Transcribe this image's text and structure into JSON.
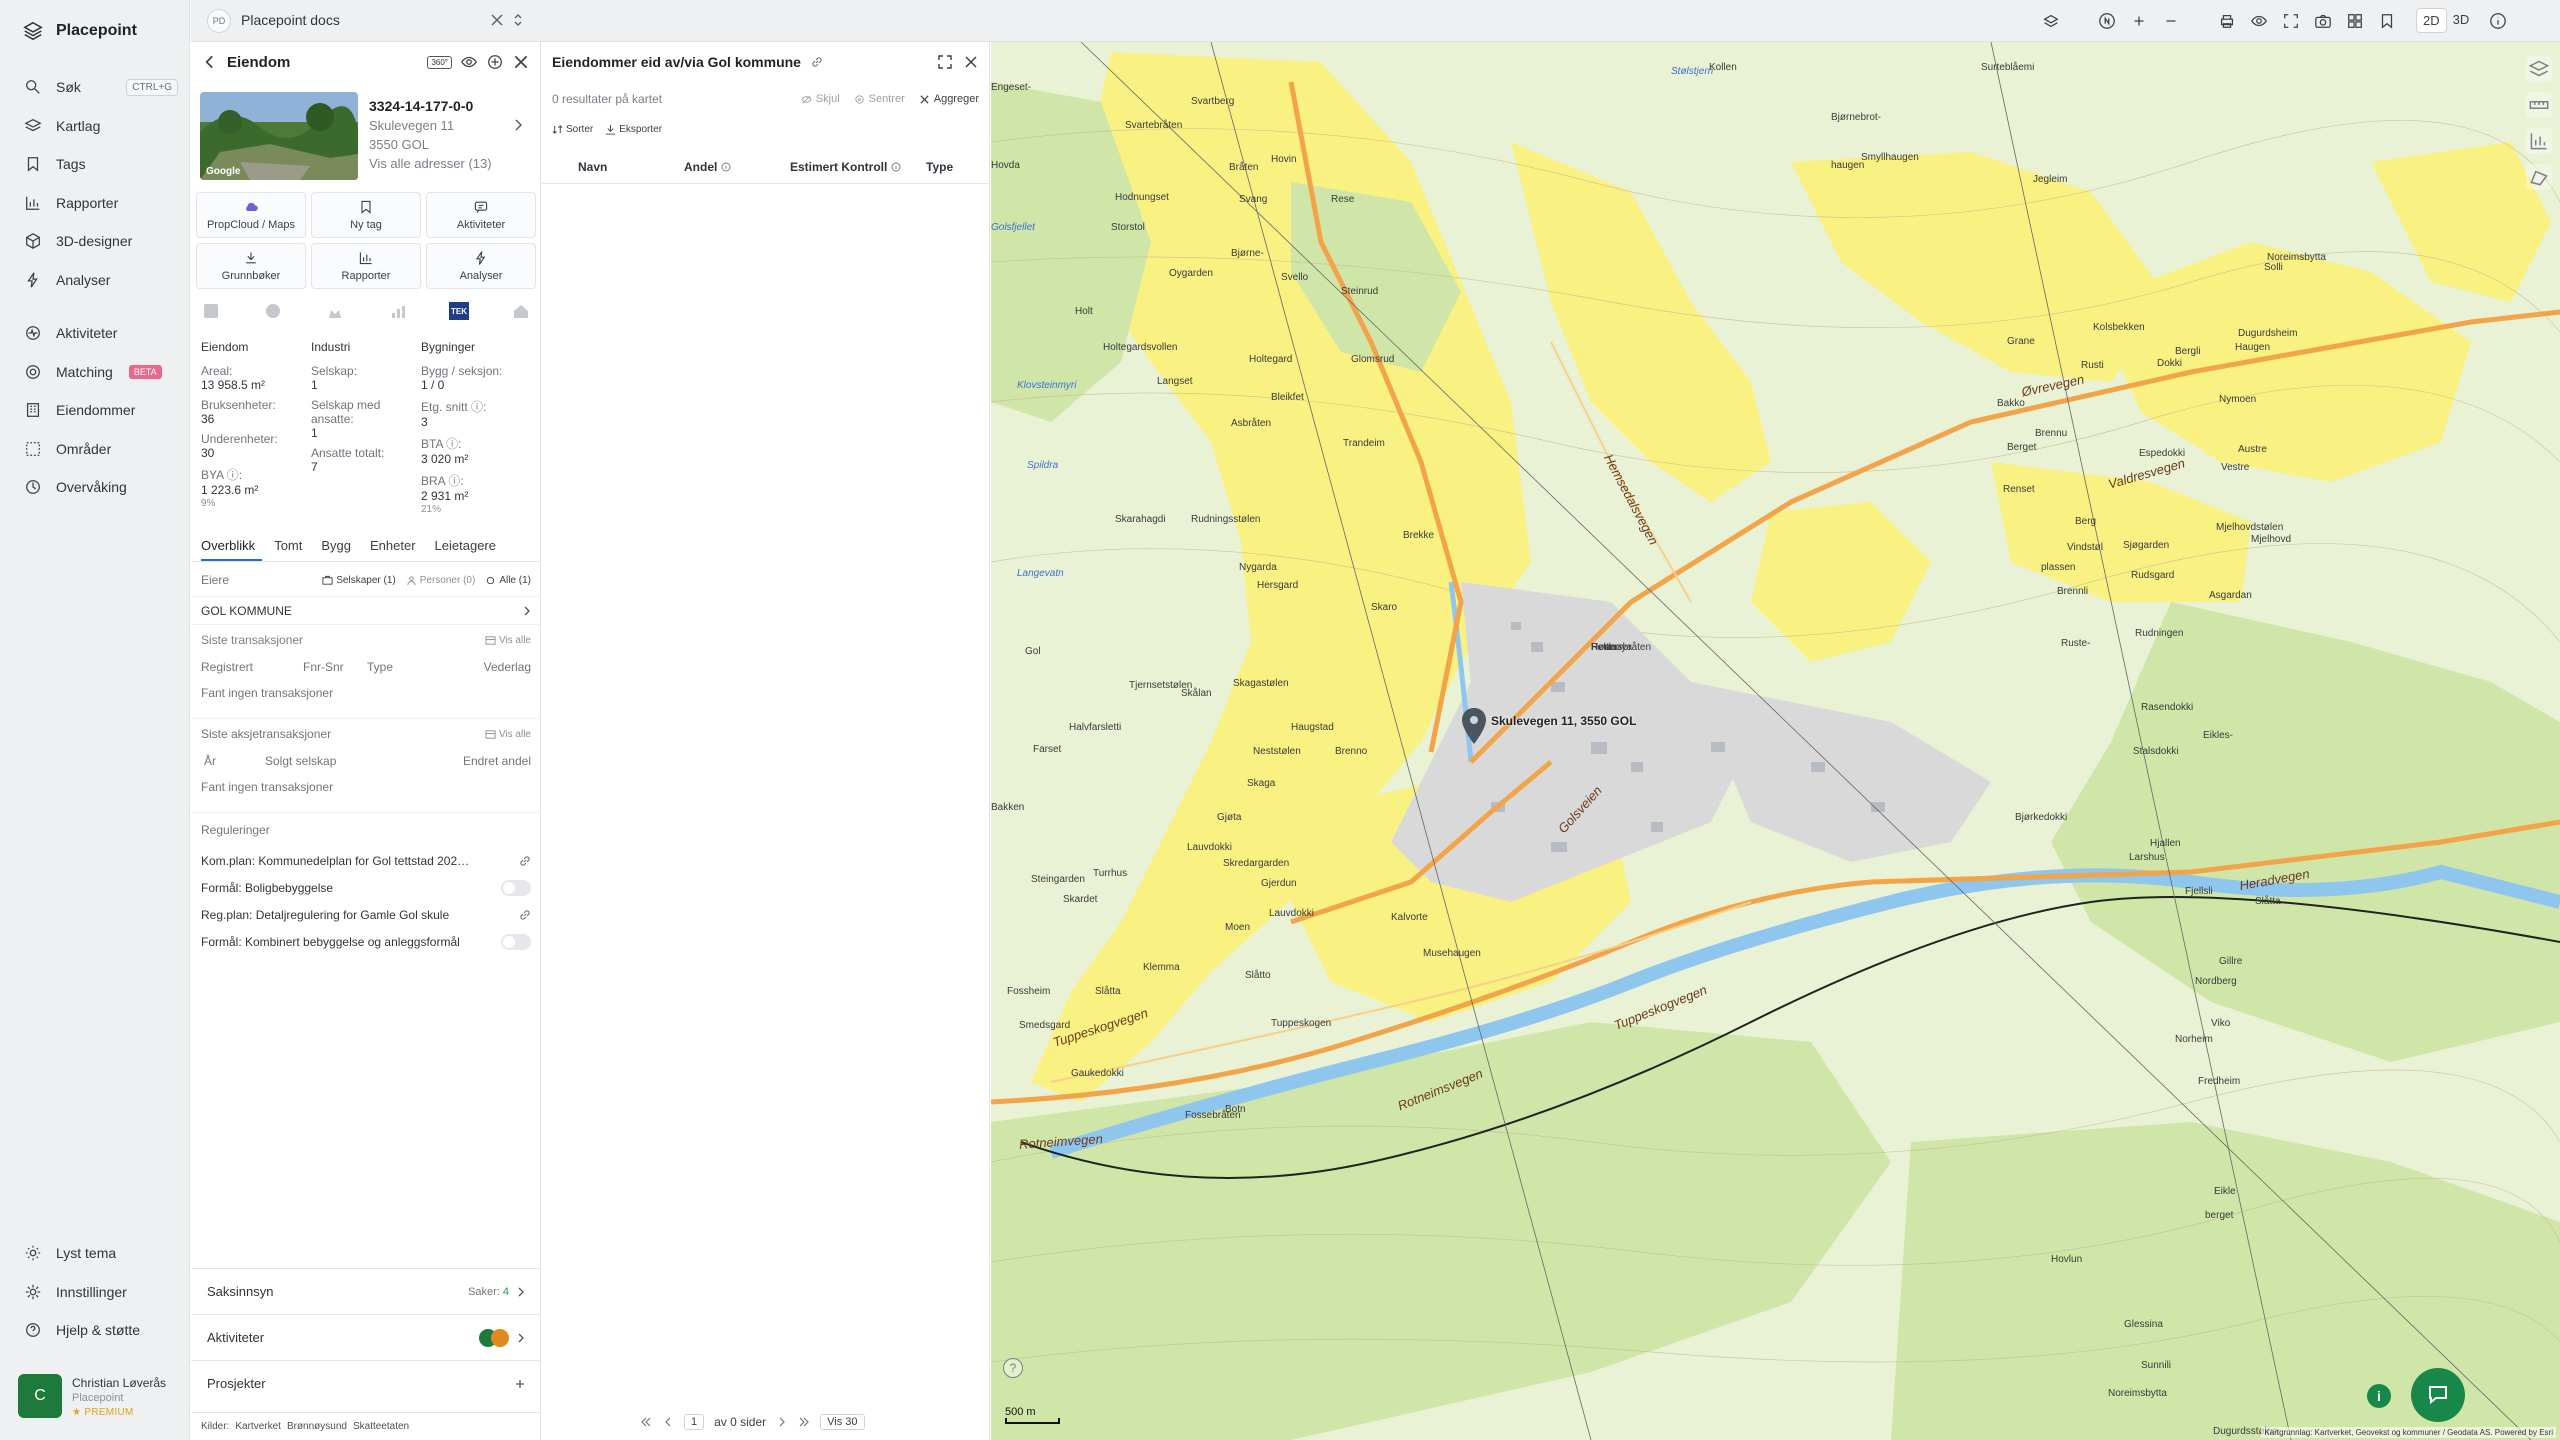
{
  "app": {
    "brand": "Placepoint"
  },
  "nav": {
    "items": [
      {
        "label": "Søk",
        "icon": "search-icon",
        "shortcut": "CTRL+G"
      },
      {
        "label": "Kartlag",
        "icon": "layers-icon"
      },
      {
        "label": "Tags",
        "icon": "bookmark-icon"
      },
      {
        "label": "Rapporter",
        "icon": "chart-icon"
      },
      {
        "label": "3D-designer",
        "icon": "cube-icon"
      },
      {
        "label": "Analyser",
        "icon": "bolt-icon"
      }
    ],
    "items2": [
      {
        "label": "Aktiviteter",
        "icon": "activity-icon"
      },
      {
        "label": "Matching",
        "icon": "target-icon",
        "badge": "BETA"
      },
      {
        "label": "Eiendommer",
        "icon": "building-icon"
      },
      {
        "label": "Områder",
        "icon": "area-icon"
      },
      {
        "label": "Overvåking",
        "icon": "monitor-icon"
      }
    ],
    "bottom": [
      {
        "label": "Lyst tema",
        "icon": "sun-icon"
      },
      {
        "label": "Innstillinger",
        "icon": "gear-icon"
      },
      {
        "label": "Hjelp & støtte",
        "icon": "help-icon"
      }
    ],
    "user": {
      "initial": "C",
      "name": "Christian Løverås",
      "org": "Placepoint",
      "plan": "PREMIUM"
    }
  },
  "workspace": {
    "badge": "PD",
    "name": "Placepoint docs"
  },
  "property": {
    "title": "Eiendom",
    "tag360": "360°",
    "photo_credit": "Google",
    "id": "3324-14-177-0-0",
    "street": "Skulevegen 11",
    "postal": "3550 GOL",
    "all_addresses": "Vis alle adresser (13)",
    "tiles": [
      "PropCloud / Maps",
      "Ny tag",
      "Aktiviteter",
      "Grunnbøker",
      "Rapporter",
      "Analyser"
    ],
    "tek_label": "TEK",
    "stats": {
      "col1": {
        "h": "Eiendom",
        "rows": [
          [
            "Areal:",
            "13 958.5 m²"
          ],
          [
            "Bruksenheter:",
            "36"
          ],
          [
            "Underenheter:",
            "30"
          ],
          [
            "BYA ⓘ:",
            "1 223.6 m²",
            "9%"
          ]
        ]
      },
      "col2": {
        "h": "Industri",
        "rows": [
          [
            "Selskap:",
            "1"
          ],
          [
            "Selskap med ansatte:",
            "1"
          ],
          [
            "Ansatte totalt:",
            "7"
          ]
        ]
      },
      "col3": {
        "h": "Bygninger",
        "rows": [
          [
            "Bygg / seksjon:",
            "1 / 0"
          ],
          [
            "Etg. snitt ⓘ:",
            "3"
          ],
          [
            "BTA ⓘ:",
            "3 020 m²"
          ],
          [
            "BRA ⓘ:",
            "2 931 m²",
            "21%"
          ]
        ]
      }
    },
    "subtabs": [
      "Overblikk",
      "Tomt",
      "Bygg",
      "Enheter",
      "Leietagere"
    ],
    "owners": {
      "label": "Eiere",
      "selskaper": "Selskaper (1)",
      "personer": "Personer (0)",
      "alle": "Alle (1)",
      "owner": "GOL KOMMUNE"
    },
    "tx": {
      "label": "Siste transaksjoner",
      "show_all": "Vis alle",
      "cols": [
        "Registrert",
        "Fnr-Snr",
        "Type",
        "Vederlag"
      ],
      "empty": "Fant ingen transaksjoner"
    },
    "stx": {
      "label": "Siste aksjetransaksjoner",
      "show_all": "Vis alle",
      "cols": [
        "År",
        "Solgt selskap",
        "Endret andel"
      ],
      "empty": "Fant ingen transaksjoner"
    },
    "reg": {
      "label": "Reguleringer",
      "rows": [
        "Kom.plan: Kommunedelplan for Gol tettstad 202…",
        "Formål: Boligbebyggelse",
        "Reg.plan: Detaljregulering for Gamle Gol skule",
        "Formål: Kombinert bebyggelse og anleggsformål"
      ]
    },
    "accordions": {
      "saksinnsyn": "Saksinnsyn",
      "saker_label": "Saker:",
      "saker_count": "4",
      "aktiviteter": "Aktiviteter",
      "prosjekter": "Prosjekter"
    },
    "sources": {
      "label": "Kilder:",
      "items": [
        "Kartverket",
        "Brønnøysund",
        "Skatteetaten"
      ]
    }
  },
  "results": {
    "title": "Eiendommer eid av/via Gol kommune",
    "count_text": "0 resultater på kartet",
    "actions": [
      "Skjul",
      "Sentrer",
      "Aggreger"
    ],
    "tools": [
      "Sorter",
      "Eksporter"
    ],
    "columns": [
      "Navn",
      "Andel",
      "Estimert Kontroll",
      "Type"
    ],
    "pager": {
      "page": "1",
      "of": "av 0 sider",
      "per_page": "Vis 30"
    }
  },
  "toolbar": {
    "mode_2d": "2D",
    "mode_3d": "3D"
  },
  "map": {
    "pin_label": "Skulevegen 11, 3550 GOL",
    "scale": "500 m",
    "credit": "Kartgrunnlag: Kartverket, Geovekst og kommuner / Geodata AS. Powered by Esri",
    "labels": [
      {
        "t": "Kollen"
      },
      {
        "t": "Surteblåemi"
      },
      {
        "t": "Engeset-"
      },
      {
        "t": "Svartebråten"
      },
      {
        "t": "Svartberg"
      },
      {
        "t": "Bjørnebrot-"
      },
      {
        "t": "Smyllhaugen"
      },
      {
        "t": "haugen"
      },
      {
        "t": "Hovda"
      },
      {
        "t": "Bråten"
      },
      {
        "t": "Hovin"
      },
      {
        "t": "Svang"
      },
      {
        "t": "Rese"
      },
      {
        "t": "Hodnungset"
      },
      {
        "t": "Storstol"
      },
      {
        "t": "Oygarden"
      },
      {
        "t": "Bjørne-"
      },
      {
        "t": "Svello"
      },
      {
        "t": "Steinrud"
      },
      {
        "t": "Holt"
      },
      {
        "t": "Holtegardsvollen"
      },
      {
        "t": "Glomsrud"
      },
      {
        "t": "Holtegard"
      },
      {
        "t": "Langset"
      },
      {
        "t": "Bleikfet"
      },
      {
        "t": "Asbråten"
      },
      {
        "t": "Trandeim"
      },
      {
        "t": "Skarahagdi"
      },
      {
        "t": "Rudningsstølen"
      },
      {
        "t": "Nygarda"
      },
      {
        "t": "Brekke"
      },
      {
        "t": "Hersgard"
      },
      {
        "t": "Skaro"
      },
      {
        "t": "Gol"
      },
      {
        "t": "Tjernsetstølen"
      },
      {
        "t": "Skålan"
      },
      {
        "t": "Halvfarsletti"
      },
      {
        "t": "Skagastølen"
      },
      {
        "t": "Haugstad"
      },
      {
        "t": "Farset"
      },
      {
        "t": "Neststølen"
      },
      {
        "t": "Brenno"
      },
      {
        "t": "Skaga"
      },
      {
        "t": "Bakken"
      },
      {
        "t": "Gjøta"
      },
      {
        "t": "Lauvdokki"
      },
      {
        "t": "Skredargarden"
      },
      {
        "t": "Turrhus"
      },
      {
        "t": "Steingarden"
      },
      {
        "t": "Skardet"
      },
      {
        "t": "Gjerdun"
      },
      {
        "t": "Lauvdokki"
      },
      {
        "t": "Kalvorte"
      },
      {
        "t": "Musehaugen"
      },
      {
        "t": "Klemma"
      },
      {
        "t": "Moen"
      },
      {
        "t": "Slåtto"
      },
      {
        "t": "Smedsgard"
      },
      {
        "t": "Tuppeskogen"
      },
      {
        "t": "Gaukedokki"
      },
      {
        "t": "Botn"
      },
      {
        "t": "Fossebråten"
      },
      {
        "t": "Slåtta"
      },
      {
        "t": "Fossheim"
      },
      {
        "t": "Jegleim"
      },
      {
        "t": "Grane"
      },
      {
        "t": "Kolsbekken"
      },
      {
        "t": "Dokki"
      },
      {
        "t": "Bergli"
      },
      {
        "t": "Haugen"
      },
      {
        "t": "Nymoen"
      },
      {
        "t": "Austre"
      },
      {
        "t": "Vestre"
      },
      {
        "t": "Rusti"
      },
      {
        "t": "Bakko"
      },
      {
        "t": "Brennu"
      },
      {
        "t": "Berget"
      },
      {
        "t": "Espedokki"
      },
      {
        "t": "Renset"
      },
      {
        "t": "Berg"
      },
      {
        "t": "Sjøgarden"
      },
      {
        "t": "Asgardan"
      },
      {
        "t": "Rudningen"
      },
      {
        "t": "Rasendokki"
      },
      {
        "t": "Stalsdokki"
      },
      {
        "t": "Bjørkedokki"
      },
      {
        "t": "Larshus"
      },
      {
        "t": "Hjallen"
      },
      {
        "t": "Fjellsli"
      },
      {
        "t": "Nordberg"
      },
      {
        "t": "Gillre"
      },
      {
        "t": "Viko"
      },
      {
        "t": "Norheim"
      },
      {
        "t": "Fredheim"
      },
      {
        "t": "Slåtta"
      },
      {
        "t": "Eikles-"
      },
      {
        "t": "berget"
      },
      {
        "t": "Eikle"
      },
      {
        "t": "Hovlun"
      },
      {
        "t": "Glessina"
      },
      {
        "t": "Sunnili"
      },
      {
        "t": "Noreimsbytta"
      },
      {
        "t": "Dugurdsstølen"
      },
      {
        "t": "Mjelhovdstølen"
      },
      {
        "t": "Mjelhovd"
      },
      {
        "t": "Dugurdsheim"
      },
      {
        "t": "Noreimsbytta"
      },
      {
        "t": "Solli"
      },
      {
        "t": "Vindstøl"
      },
      {
        "t": "Brennli"
      },
      {
        "t": "Ruste-"
      },
      {
        "t": "plassen"
      },
      {
        "t": "Rudsgard"
      },
      {
        "t": "Pettersbråten"
      },
      {
        "t": "Heia"
      },
      {
        "t": "Rønnøya"
      },
      {
        "t": "Hesla"
      }
    ],
    "roads": [
      "Øvrevegen",
      "Valdresvegen",
      "Hemsedalsvegen",
      "Golsveien",
      "Tuppeskogvegen",
      "Tuppeskogvegen",
      "Rotneimsvegen",
      "Rotneimvegen",
      "Heradvegen"
    ],
    "water": [
      "Klovsteinmyri",
      "Spildra",
      "Langevatn",
      "Stølstjern",
      "Golsfjellet"
    ]
  }
}
